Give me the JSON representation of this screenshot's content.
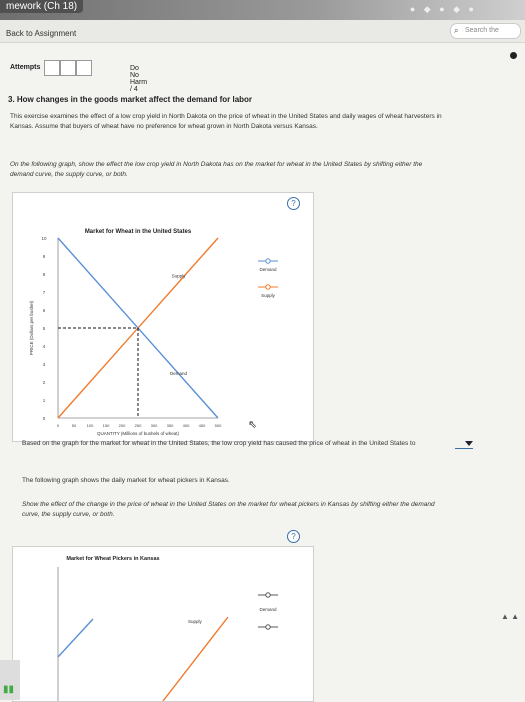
{
  "browser": {
    "tab_title": "mework (Ch 18)",
    "search_placeholder": "Search the"
  },
  "nav": {
    "back_label": "Back to Assignment"
  },
  "header": {
    "attempts_label": "Attempts",
    "score_label": "Do No Harm / 4"
  },
  "question": {
    "title": "3. How changes in the goods market affect the demand for labor",
    "intro_line1": "This exercise examines the effect of a low crop yield in North Dakota on the price of wheat in the United States and daily wages of wheat harvesters in",
    "intro_line2": "Kansas. Assume that buyers of wheat have no preference for wheat grown in North Dakota versus Kansas.",
    "instr1_line1": "On the following graph, show the effect the low crop yield in North Dakota has on the market for wheat in the United States by shifting either the",
    "instr1_line2": "demand curve, the supply curve, or both.",
    "help_symbol": "?",
    "result_text": "Based on the graph for the market for wheat in the United States, the low crop yield has caused the price of wheat in the United States to",
    "kansas_intro": "The following graph shows the daily market for wheat pickers in Kansas.",
    "instr2_line1": "Show the effect of the change in the price of wheat in the United States on the market for wheat pickers in Kansas by shifting either the demand",
    "instr2_line2": "curve, the supply curve, or both."
  },
  "chart_data": [
    {
      "type": "line",
      "title": "Market for Wheat in the United States",
      "xlabel": "QUANTITY (Millions of bushels of wheat)",
      "ylabel": "PRICE (Dollars per bushel)",
      "x_ticks": [
        "0",
        "50",
        "100",
        "150",
        "200",
        "250",
        "300",
        "350",
        "400",
        "450",
        "500"
      ],
      "y_ticks": [
        "0",
        "1",
        "2",
        "3",
        "4",
        "5",
        "6",
        "7",
        "8",
        "9",
        "10"
      ],
      "xlim": [
        0,
        500
      ],
      "ylim": [
        0,
        10
      ],
      "series": [
        {
          "name": "Supply",
          "color": "#f07a2a",
          "x": [
            0,
            500
          ],
          "y": [
            0,
            10
          ]
        },
        {
          "name": "Demand",
          "color": "#5a8fd6",
          "x": [
            0,
            500
          ],
          "y": [
            10,
            0
          ]
        }
      ],
      "equilibrium": {
        "x": 250,
        "y": 5
      },
      "legend": [
        "Demand",
        "Supply"
      ],
      "legend_position": "right"
    },
    {
      "type": "line",
      "title": "Market for Wheat Pickers in Kansas",
      "series_labels": [
        "Supply"
      ],
      "legend": [
        "Demand"
      ],
      "legend_position": "right"
    }
  ]
}
